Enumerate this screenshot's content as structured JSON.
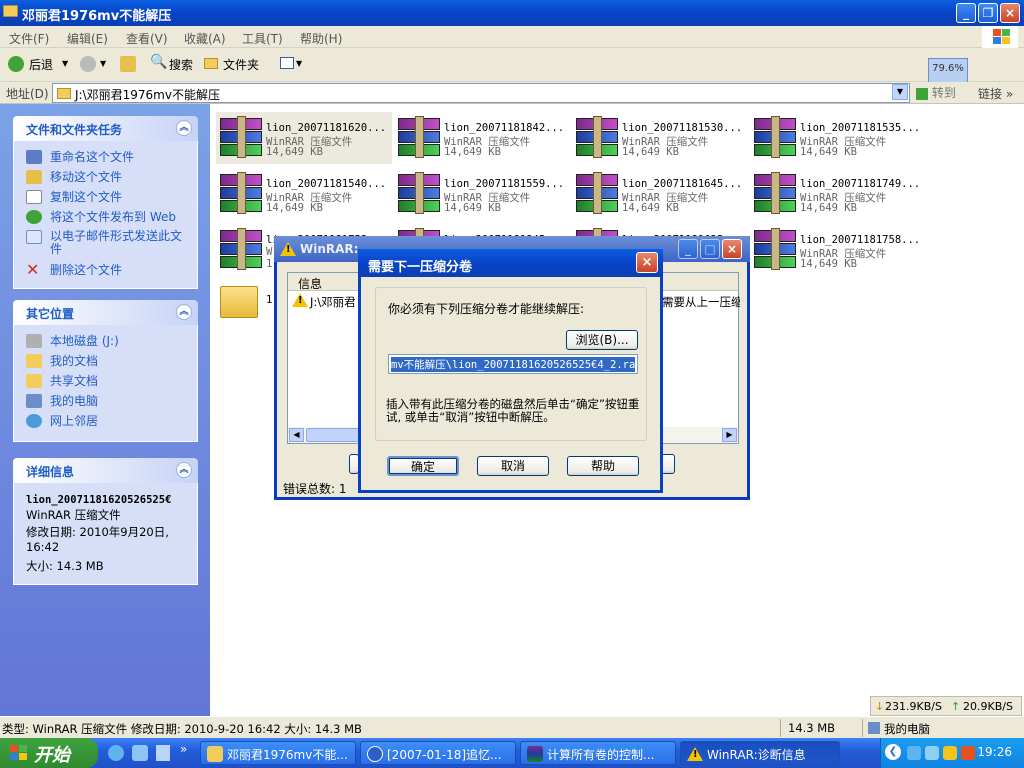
{
  "window": {
    "title": "邓丽君1976mv不能解压"
  },
  "menu": [
    "文件(F)",
    "编辑(E)",
    "查看(V)",
    "收藏(A)",
    "工具(T)",
    "帮助(H)"
  ],
  "toolbar": {
    "back": "后退",
    "search": "搜索",
    "folders": "文件夹",
    "speed_pct": "79.6%",
    "speed_go": "转到"
  },
  "address": {
    "label": "地址(D)",
    "path": "J:\\邓丽君1976mv不能解压",
    "go": "转到",
    "links": "链接"
  },
  "left": {
    "tasks_title": "文件和文件夹任务",
    "tasks": [
      "重命名这个文件",
      "移动这个文件",
      "复制这个文件",
      "将这个文件发布到 Web",
      "以电子邮件形式发送此文件",
      "删除这个文件"
    ],
    "places_title": "其它位置",
    "places": [
      "本地磁盘 (J:)",
      "我的文档",
      "共享文档",
      "我的电脑",
      "网上邻居"
    ],
    "details_title": "详细信息",
    "details_name": "lion_20071181620526525€",
    "details_type": "WinRAR 压缩文件",
    "details_date": "修改日期: 2010年9月20日, 16:42",
    "details_size": "大小: 14.3 MB"
  },
  "files": [
    {
      "name": "lion_20071181620...",
      "type": "WinRAR 压缩文件",
      "size": "14,649 KB"
    },
    {
      "name": "lion_20071181842...",
      "type": "WinRAR 压缩文件",
      "size": "14,649 KB"
    },
    {
      "name": "lion_20071181530...",
      "type": "WinRAR 压缩文件",
      "size": "14,649 KB"
    },
    {
      "name": "lion_20071181535...",
      "type": "WinRAR 压缩文件",
      "size": "14,649 KB"
    },
    {
      "name": "lion_20071181540...",
      "type": "WinRAR 压缩文件",
      "size": "14,649 KB"
    },
    {
      "name": "lion_20071181559...",
      "type": "WinRAR 压缩文件",
      "size": "14,649 KB"
    },
    {
      "name": "lion_20071181645...",
      "type": "WinRAR 压缩文件",
      "size": "14,649 KB"
    },
    {
      "name": "lion_20071181749...",
      "type": "WinRAR 压缩文件",
      "size": "14,649 KB"
    },
    {
      "name": "lion_20071181753...",
      "type": "W",
      "size": "1"
    },
    {
      "name": "lion_20071181845...",
      "type": "",
      "size": ""
    },
    {
      "name": "lion_20071181625...",
      "type": "",
      "size": ""
    },
    {
      "name": "lion_20071181758...",
      "type": "WinRAR 压缩文件",
      "size": "14,649 KB"
    }
  ],
  "folder_label": "1",
  "diag": {
    "title": "WinRAR:",
    "col_header": "信息",
    "row_text": "J:\\邓丽君",
    "row_right": "需要从上一压缩",
    "errors": "错误总数: 1"
  },
  "volume_dialog": {
    "title": "需要下一压缩分卷",
    "message": "你必须有下列压缩分卷才能继续解压:",
    "browse": "浏览(B)...",
    "path": "mv不能解压\\lion_20071181620526525€4_2.rar",
    "instruction": "插入带有此压缩分卷的磁盘然后单击“确定”按钮重试, 或单击“取消”按钮中断解压。",
    "ok": "确定",
    "cancel": "取消",
    "help": "帮助"
  },
  "status": {
    "info": "类型: WinRAR 压缩文件 修改日期: 2010-9-20 16:42 大小: 14.3 MB",
    "size": "14.3 MB",
    "location": "我的电脑",
    "down": "231.9KB/S",
    "up": "20.9KB/S"
  },
  "taskbar": {
    "start": "开始",
    "tasks": [
      "邓丽君1976mv不能...",
      "[2007-01-18]追忆...",
      "计算所有卷的控制...",
      "WinRAR:诊断信息"
    ],
    "clock": "19:26"
  }
}
